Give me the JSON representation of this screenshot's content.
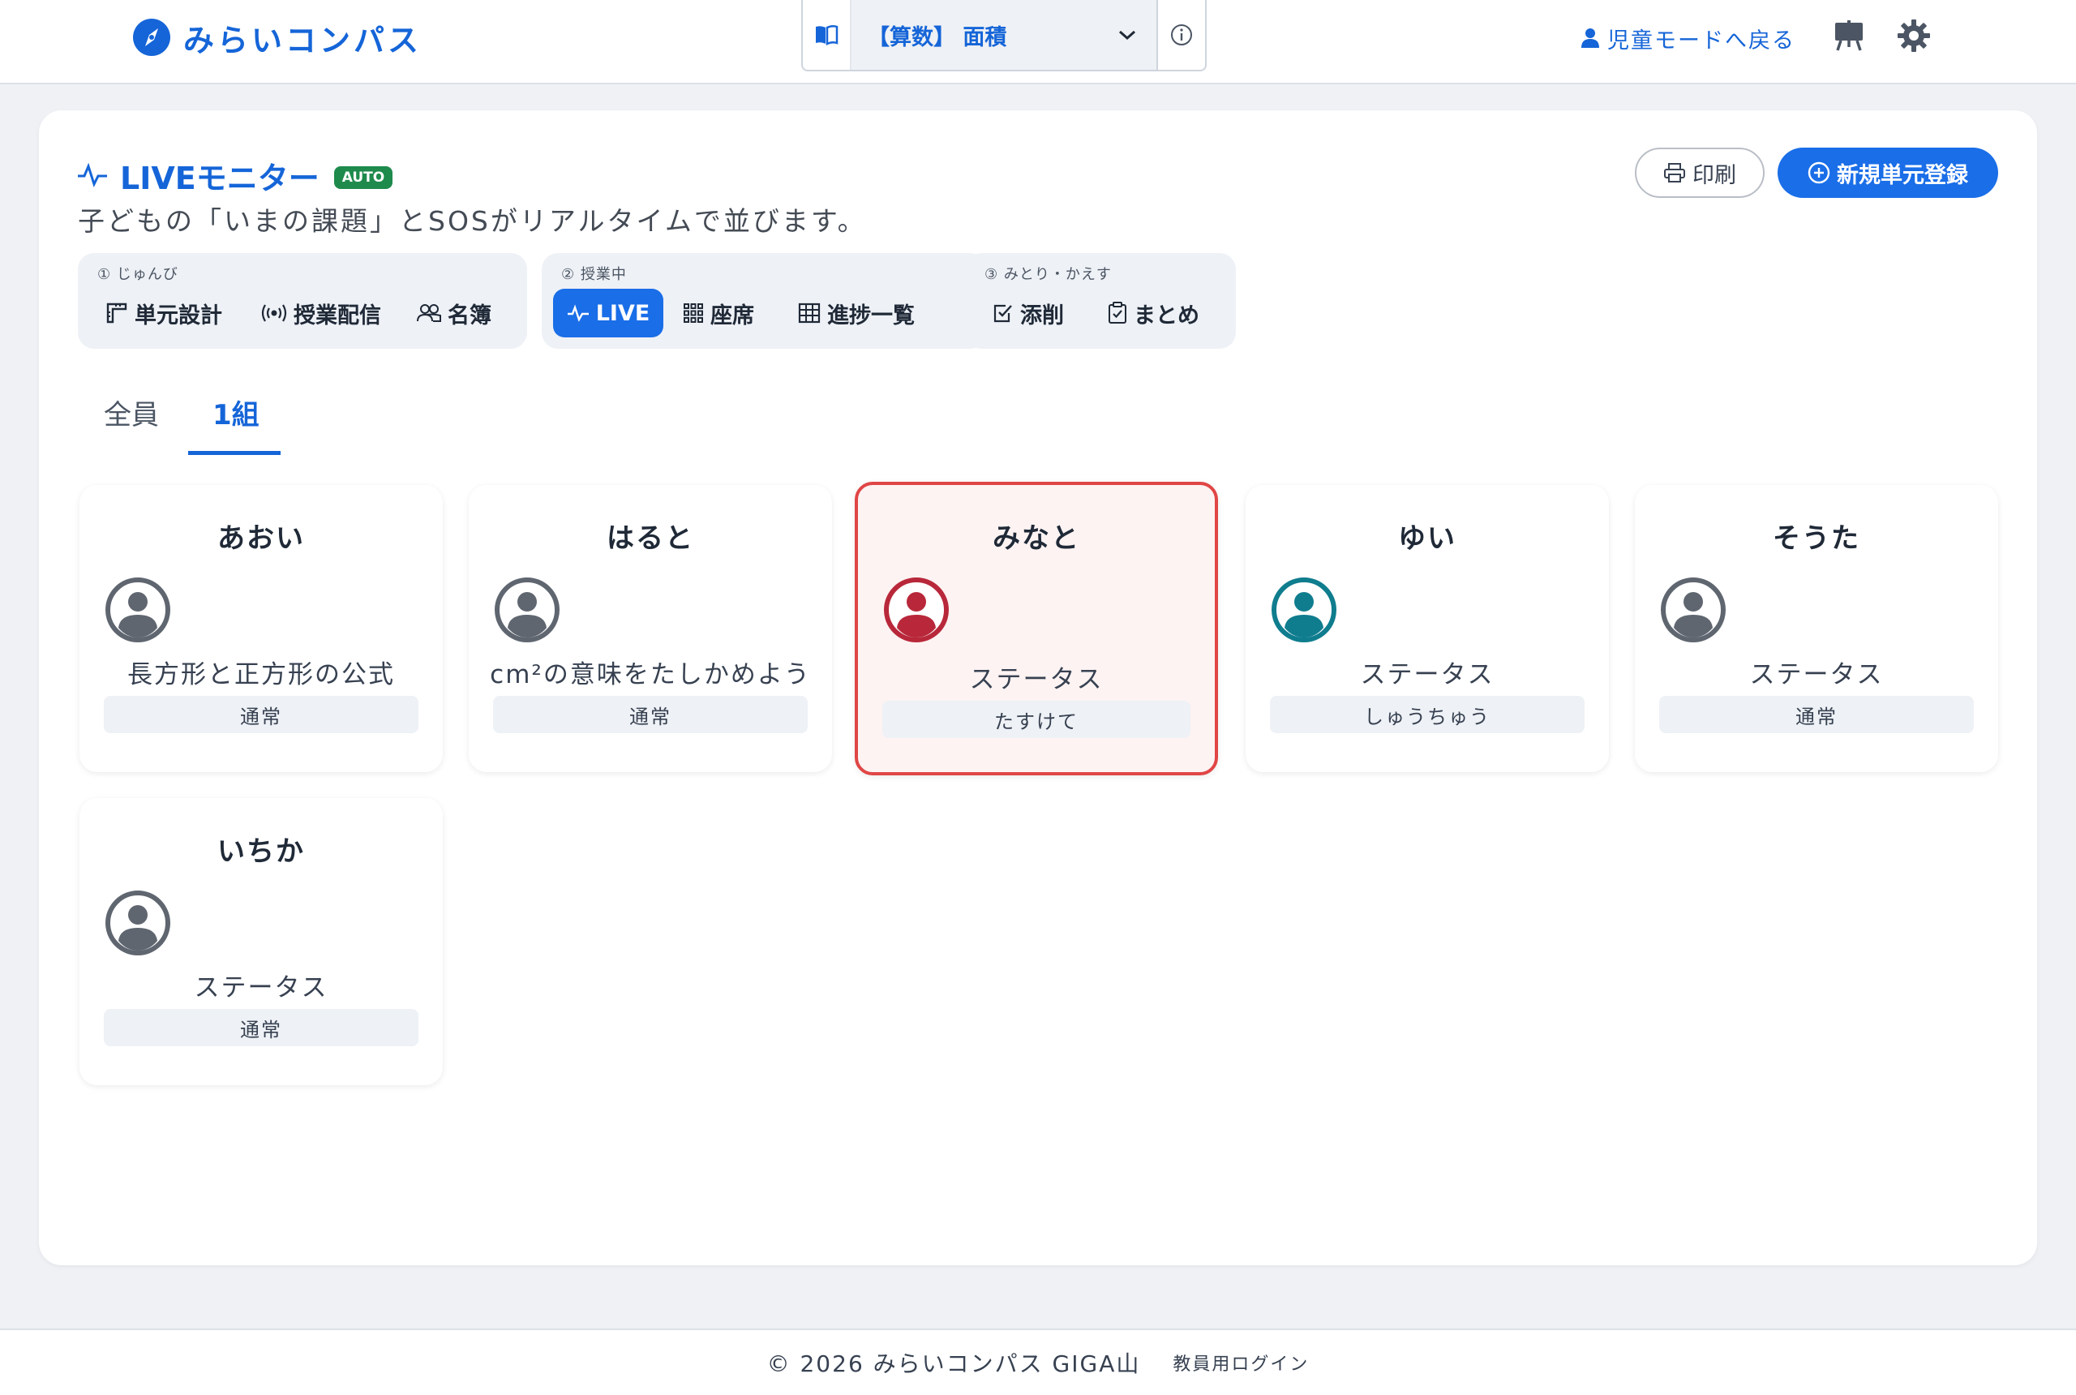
{
  "header": {
    "brand": "みらいコンパス",
    "unit_select": {
      "value": "【算数】 面積"
    },
    "child_mode_label": "児童モードへ戻る"
  },
  "monitor": {
    "title": "LIVEモニター",
    "badge": "AUTO",
    "subtitle": "子どもの「いまの課題」とSOSがリアルタイムで並びます。",
    "print_label": "印刷",
    "new_unit_label": "新規単元登録"
  },
  "steps": [
    {
      "label": "① じゅんび",
      "items": [
        "単元設計",
        "授業配信",
        "名簿"
      ]
    },
    {
      "label": "② 授業中",
      "items": [
        "LIVE",
        "座席",
        "進捗一覧"
      ]
    },
    {
      "label": "③ みとり・かえす",
      "items": [
        "添削",
        "まとめ"
      ]
    }
  ],
  "tabs": [
    "全員",
    "1組"
  ],
  "students": [
    {
      "name": "あおい",
      "task": "長方形と正方形の公式",
      "status": "通常",
      "avatar_color": "#5f6670"
    },
    {
      "name": "はると",
      "task": "cm²の意味をたしかめよう",
      "status": "通常",
      "avatar_color": "#5f6670"
    },
    {
      "name": "みなと",
      "task": "ステータス",
      "status": "たすけて",
      "avatar_color": "#b8283a"
    },
    {
      "name": "ゆい",
      "task": "ステータス",
      "status": "しゅうちゅう",
      "avatar_color": "#0f7d8e"
    },
    {
      "name": "そうた",
      "task": "ステータス",
      "status": "通常",
      "avatar_color": "#5f6670"
    },
    {
      "name": "いちか",
      "task": "ステータス",
      "status": "通常",
      "avatar_color": "#5f6670"
    }
  ],
  "footer": {
    "copyright": "© 2026 みらいコンパス GIGA山",
    "login": "教員用ログイン"
  },
  "colors": {
    "accent": "#1565d8",
    "primary_button": "#1a6ee8",
    "auto_badge": "#1e8a4c",
    "sos_border": "#e04646"
  }
}
